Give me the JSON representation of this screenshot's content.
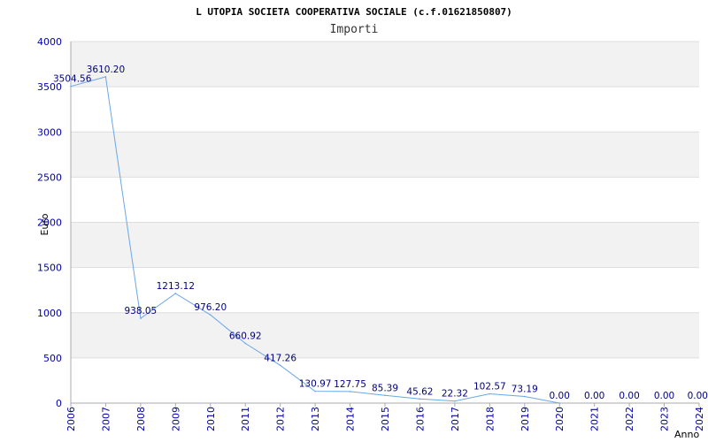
{
  "chart_data": {
    "type": "line",
    "title": "L UTOPIA SOCIETA COOPERATIVA SOCIALE (c.f.01621850807)",
    "subtitle": "Importi",
    "xlabel": "Anno",
    "ylabel": "Euro",
    "categories": [
      "2006",
      "2007",
      "2008",
      "2009",
      "2010",
      "2011",
      "2012",
      "2013",
      "2014",
      "2015",
      "2016",
      "2017",
      "2018",
      "2019",
      "2020",
      "2021",
      "2022",
      "2023",
      "2024"
    ],
    "values": [
      3504.56,
      3610.2,
      938.05,
      1213.12,
      976.2,
      660.92,
      417.26,
      130.97,
      127.75,
      85.39,
      45.62,
      22.32,
      102.57,
      73.19,
      0.0,
      null,
      null,
      null,
      null
    ],
    "data_labels": [
      "3504.56",
      "3610.20",
      "938.05",
      "1213.12",
      "976.20",
      "660.92",
      "417.26",
      "130.97",
      "127.75",
      "85.39",
      "45.62",
      "22.32",
      "102.57",
      "73.19",
      "0.00",
      "0.00",
      "0.00",
      "0.00",
      "0.00"
    ],
    "ylim": [
      0,
      4000
    ],
    "yticks": [
      0,
      500,
      1000,
      1500,
      2000,
      2500,
      3000,
      3500,
      4000
    ],
    "grid": true,
    "band_colors": [
      "#ffffff",
      "#f2f2f2"
    ],
    "colors": {
      "line": "#6aa6e8",
      "tick_text": "#0000aa",
      "data_text": "#000080",
      "grid": "#dddddd",
      "axis": "#aaaaaa"
    }
  }
}
